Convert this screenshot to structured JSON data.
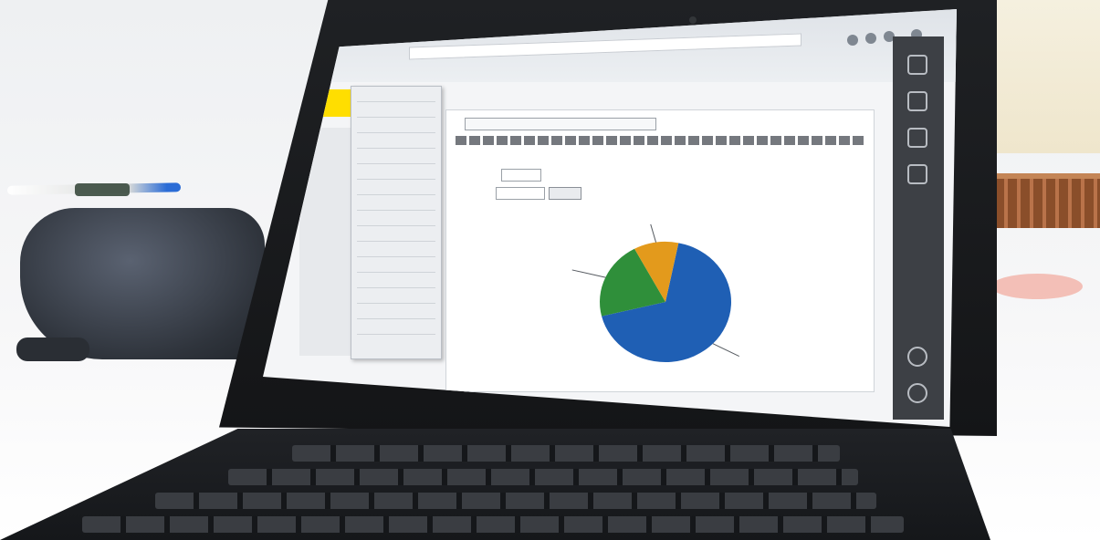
{
  "scene": {
    "description_tags": [
      "laptop-photo"
    ],
    "colors": {
      "logo_yellow": "#ffde00",
      "pie_blue": "#1f5fb4",
      "pie_orange": "#e39a1c",
      "pie_green": "#2f8f3a"
    }
  },
  "screen": {
    "brand_text": "",
    "nav_items": [
      "",
      "",
      "",
      "",
      "",
      "",
      "",
      "",
      "",
      "",
      "",
      "",
      "",
      "",
      "",
      ""
    ],
    "question_text": "",
    "dropdown_value": "",
    "filter_value": "",
    "apply_label": ""
  },
  "chart_data": {
    "type": "pie",
    "title": "",
    "slices": [
      {
        "label": "",
        "value": 68
      },
      {
        "label": "",
        "value": 21
      },
      {
        "label": "",
        "value": 11
      }
    ],
    "legend": "callouts"
  }
}
